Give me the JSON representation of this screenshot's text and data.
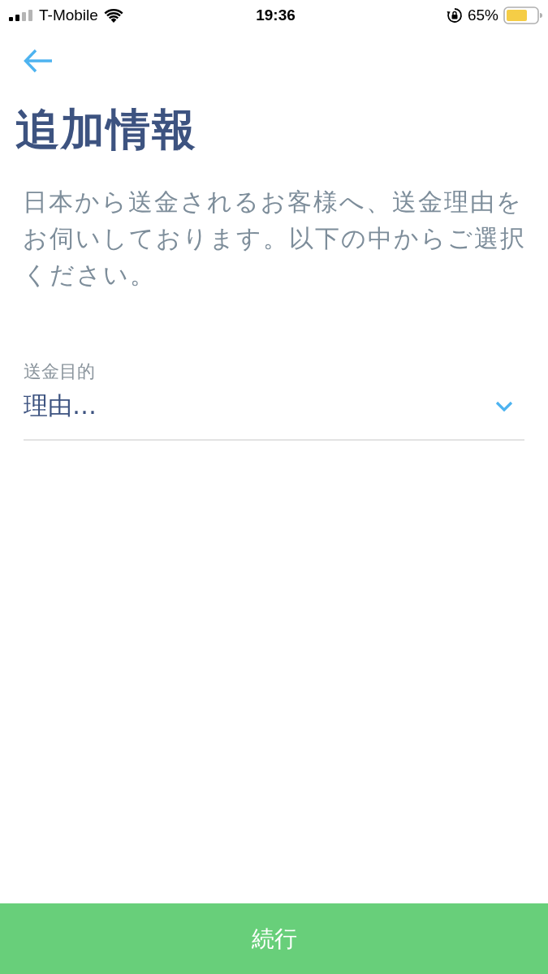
{
  "status_bar": {
    "carrier": "T-Mobile",
    "time": "19:36",
    "battery": "65%"
  },
  "title": "追加情報",
  "description": "日本から送金されるお客様へ、送金理由をお伺いしております。以下の中からご選択ください。",
  "fields": [
    {
      "label": "送金目的",
      "value": "理由…"
    }
  ],
  "continue_button": "続行"
}
